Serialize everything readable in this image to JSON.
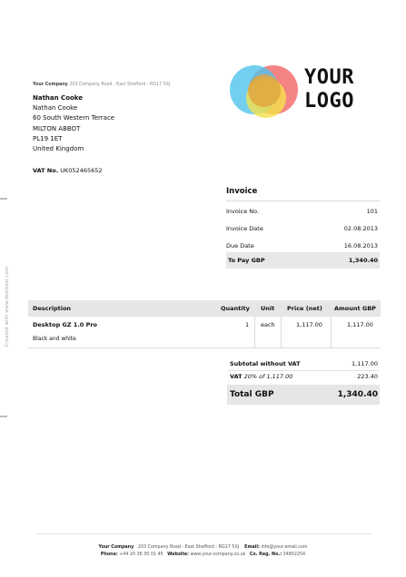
{
  "sidebar": {
    "credit": "Created with www.debitoor.com"
  },
  "sender_line": {
    "company": "Your Company",
    "address": "203 Company Road - East Shefford - RG17 5XJ"
  },
  "recipient": {
    "name": "Nathan Cooke",
    "lines": [
      "Nathan Cooke",
      "60 South Western Terrace",
      "MILTON ABBOT",
      "PL19 1ET",
      "United Kingdom"
    ]
  },
  "vat": {
    "label": "VAT No.",
    "value": "UK052465652"
  },
  "logo": {
    "text_line1": "YOUR",
    "text_line2": "LOGO",
    "colors": [
      "#f2706f",
      "#4fc3ec",
      "#f5e14a",
      "#e2a640"
    ]
  },
  "invoice": {
    "title": "Invoice",
    "number_label": "Invoice No.",
    "number": "101",
    "date_label": "Invoice Date",
    "date": "02.08.2013",
    "due_label": "Due Date",
    "due": "16.08.2013",
    "topay_label": "To Pay GBP",
    "topay": "1,340.40"
  },
  "table": {
    "headers": {
      "description": "Description",
      "quantity": "Quantity",
      "unit": "Unit",
      "price": "Price (net)",
      "amount": "Amount GBP"
    },
    "rows": [
      {
        "description": "Desktop GZ 1.0 Pro",
        "sub": "Black and white",
        "quantity": "1",
        "unit": "each",
        "price": "1,117.00",
        "amount": "1,117.00"
      }
    ]
  },
  "totals": {
    "subtotal_label": "Subtotal without VAT",
    "subtotal": "1,117.00",
    "vat_label": "VAT",
    "vat_detail": "20% of 1,117.00",
    "vat_amount": "223.40",
    "total_label": "Total GBP",
    "total": "1,340.40"
  },
  "footer": {
    "company_label": "Your Company",
    "company_address": "203 Company Road - East Shefford - RG17 5XJ",
    "email_label": "Email:",
    "email": "info@your-email.com",
    "phone_label": "Phone:",
    "phone": "+44 20 36 30 01 45",
    "website_label": "Website:",
    "website": "www.your-company.co.uk",
    "reg_label": "Co. Reg. No.:",
    "reg": "34802254"
  },
  "colors": {
    "header_bg": "#e6e6e6",
    "text": "#111111",
    "muted": "#8c8c8c"
  }
}
